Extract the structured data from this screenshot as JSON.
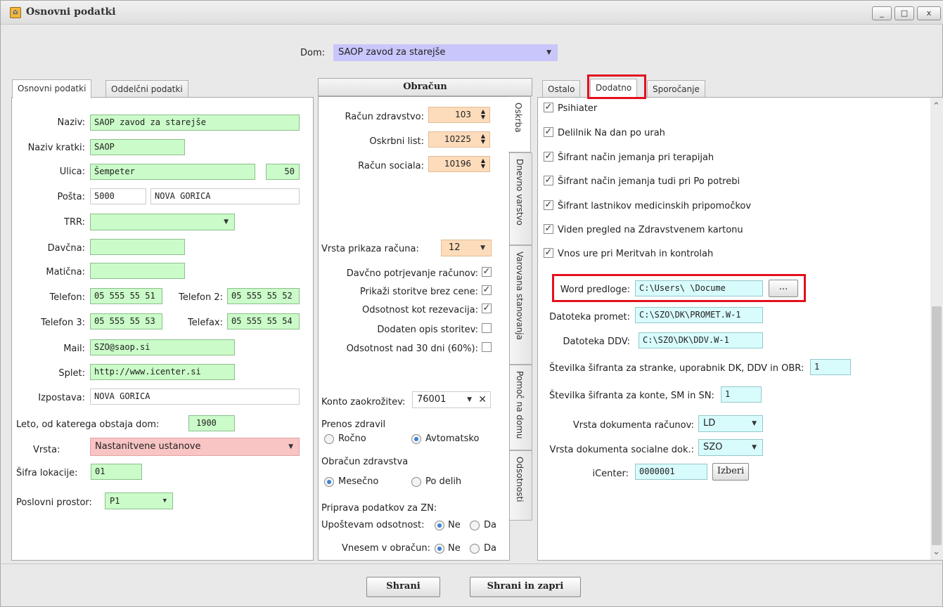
{
  "window": {
    "title": "Osnovni podatki",
    "controls": [
      "_",
      "□",
      "x"
    ]
  },
  "dom": {
    "label": "Dom:",
    "value": "SAOP zavod za starejše"
  },
  "left": {
    "tabs": [
      "Osnovni podatki",
      "Oddelčni podatki"
    ],
    "naziv": {
      "label": "Naziv:",
      "value": "SAOP zavod za starejše"
    },
    "naziv_kratki": {
      "label": "Naziv kratki:",
      "value": "SAOP"
    },
    "ulica": {
      "label": "Ulica:",
      "value": "Šempeter",
      "number": "50"
    },
    "posta": {
      "label": "Pošta:",
      "code": "5000",
      "city": "NOVA GORICA"
    },
    "trr": {
      "label": "TRR:",
      "value": ""
    },
    "davcna": {
      "label": "Davčna:",
      "value": ""
    },
    "maticna": {
      "label": "Matična:",
      "value": ""
    },
    "telefon": {
      "label": "Telefon:",
      "value": "05 555 55 51"
    },
    "telefon2": {
      "label": "Telefon 2:",
      "value": "05 555 55 52"
    },
    "telefon3": {
      "label": "Telefon 3:",
      "value": "05 555 55 53"
    },
    "telefax": {
      "label": "Telefax:",
      "value": "05 555 55 54"
    },
    "mail": {
      "label": "Mail:",
      "value": "SZO@saop.si"
    },
    "splet": {
      "label": "Splet:",
      "value": "http://www.icenter.si"
    },
    "izpostava": {
      "label": "Izpostava:",
      "value": "NOVA GORICA"
    },
    "leto": {
      "label": "Leto, od katerega obstaja dom:",
      "value": "1900"
    },
    "vrsta": {
      "label": "Vrsta:",
      "value": "Nastanitvene ustanove"
    },
    "sifra_lokacije": {
      "label": "Šifra lokacije:",
      "value": "01"
    },
    "poslovni_prostor": {
      "label": "Poslovni prostor:",
      "value": "P1"
    }
  },
  "middle": {
    "header": "Obračun",
    "vtabs": [
      "Oskrba",
      "Dnevno varstvo",
      "Varovana stanovanja",
      "Pomoč na domu",
      "Odsotnosti"
    ],
    "racun_zdravstvo": {
      "label": "Račun zdravstvo:",
      "value": "103"
    },
    "oskrbni_list": {
      "label": "Oskrbni list:",
      "value": "10225"
    },
    "racun_sociala": {
      "label": "Račun sociala:",
      "value": "10196"
    },
    "vrsta_prikaza": {
      "label": "Vrsta prikaza računa:",
      "value": "12"
    },
    "checks": [
      {
        "label": "Davčno potrjevanje računov:",
        "checked": true
      },
      {
        "label": "Prikaži storitve brez cene:",
        "checked": true
      },
      {
        "label": "Odsotnost kot rezevacija:",
        "checked": true
      },
      {
        "label": "Dodaten opis storitev:",
        "checked": false
      },
      {
        "label": "Odsotnost nad 30 dni (60%):",
        "checked": false
      }
    ],
    "konto": {
      "label": "Konto zaokrožitev:",
      "value": "76001"
    },
    "prenos": {
      "label": "Prenos zdravil",
      "opt1": "Ročno",
      "opt2": "Avtomatsko"
    },
    "obracun_zdr": {
      "label": "Obračun zdravstva",
      "opt1": "Mesečno",
      "opt2": "Po delih"
    },
    "priprava": {
      "label": "Priprava podatkov za ZN:"
    },
    "upostevam": {
      "label": "Upoštevam odsotnost:",
      "opt1": "Ne",
      "opt2": "Da"
    },
    "vnesem": {
      "label": "Vnesem v obračun:",
      "opt1": "Ne",
      "opt2": "Da"
    }
  },
  "right": {
    "tabs": [
      "Ostalo",
      "Dodatno",
      "Sporočanje"
    ],
    "checks": [
      "Psihiater",
      "Delilnik Na dan po urah",
      "Šifrant način jemanja pri terapijah",
      "Šifrant način jemanja tudi pri Po potrebi",
      "Šifrant lastnikov medicinskih pripomočkov",
      "Viden pregled na Zdravstvenem kartonu",
      "Vnos ure pri Meritvah in kontrolah"
    ],
    "word": {
      "label": "Word predloge:",
      "value": "C:\\Users\\            \\Docume",
      "button": "..."
    },
    "promet": {
      "label": "Datoteka promet:",
      "value": "C:\\SZO\\DK\\PROMET.W-1"
    },
    "ddv": {
      "label": "Datoteka DDV:",
      "value": "C:\\SZO\\DK\\DDV.W-1"
    },
    "sifrant_stranke": {
      "label": "Številka šifranta za stranke, uporabnik DK, DDV in OBR:",
      "value": "1"
    },
    "sifrant_konte": {
      "label": "Številka šifranta za konte, SM in SN:",
      "value": "1"
    },
    "vrsta_racunov": {
      "label": "Vrsta dokumenta računov:",
      "value": "LD"
    },
    "vrsta_socialne": {
      "label": "Vrsta dokumenta socialne dok.:",
      "value": "SZO"
    },
    "icenter": {
      "label": "iCenter:",
      "value": "0000001",
      "button": "Izberi"
    }
  },
  "footer": {
    "save": "Shrani",
    "save_close": "Shrani in zapri"
  }
}
